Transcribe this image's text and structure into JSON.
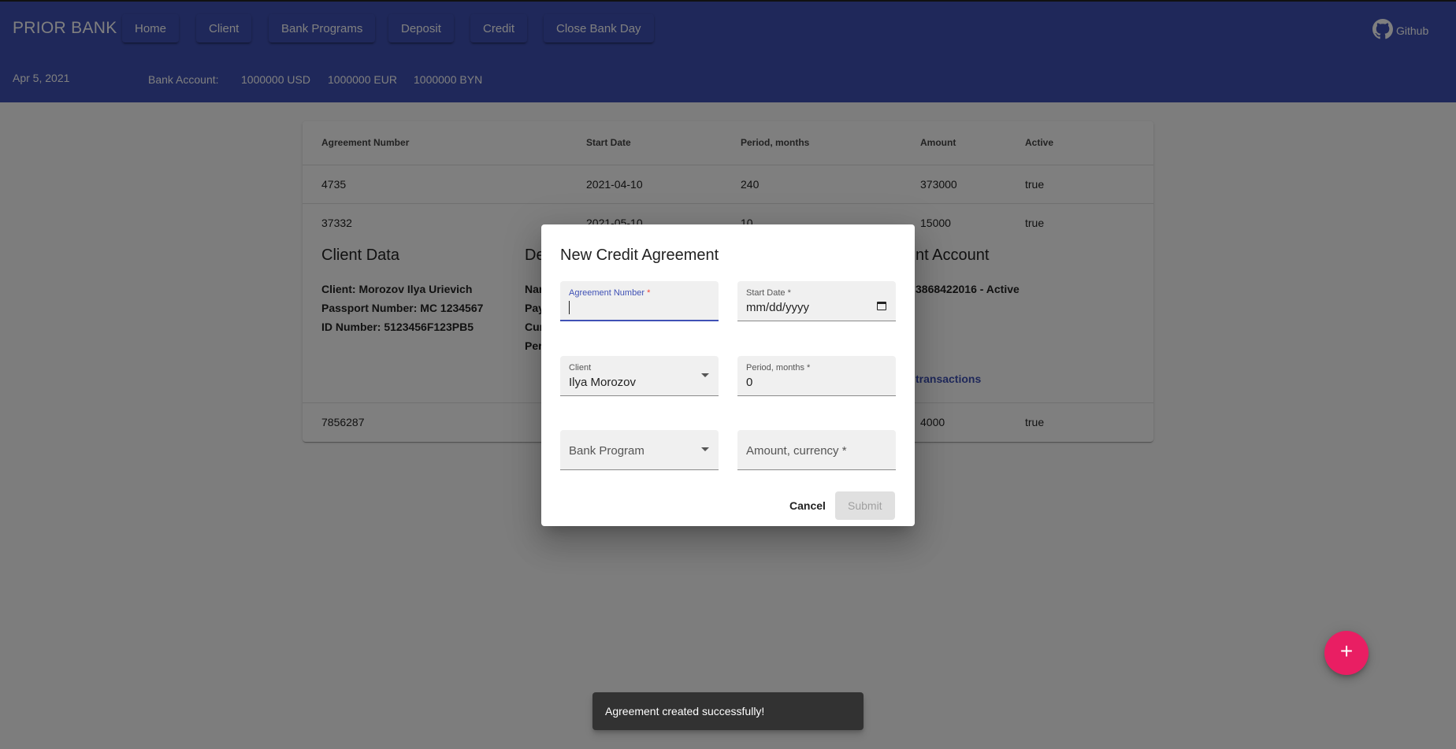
{
  "app": {
    "brand": "PRIOR BANK",
    "nav": [
      "Home",
      "Client",
      "Bank Programs",
      "Deposit",
      "Credit",
      "Close Bank Day"
    ],
    "github": "Github",
    "date": "Apr 5, 2021",
    "bank_account_label": "Bank Account:",
    "bank_accounts": [
      "1000000 USD",
      "1000000 EUR",
      "1000000 BYN"
    ]
  },
  "table": {
    "headers": [
      "Agreement Number",
      "Start Date",
      "Period, months",
      "Amount",
      "Active"
    ],
    "rows": [
      [
        "4735",
        "2021-04-10",
        "240",
        "373000",
        "true"
      ],
      [
        "37332",
        "2021-05-10",
        "10",
        "15000",
        "true"
      ],
      [
        "7856287",
        "",
        "",
        "4000",
        "true"
      ]
    ],
    "details": {
      "client_heading": "Client Data",
      "client_lines": [
        "Client: Morozov Ilya Urievich",
        "Passport Number: MC 1234567",
        "ID Number: 5123456F123PB5"
      ],
      "deposit_heading_fragment": "De",
      "deposit_fragments": [
        "Nar",
        "Pay",
        "Cur",
        "Per"
      ],
      "account_heading_fragment": "nt Account",
      "account_line_fragment": "3868422016 - Active",
      "transactions_link_fragment": "transactions"
    }
  },
  "dialog": {
    "title": "New Credit Agreement",
    "fields": {
      "agreement_number": {
        "label": "Agreement Number",
        "value": ""
      },
      "start_date": {
        "label": "Start Date",
        "value": "mm/dd/yyyy"
      },
      "client": {
        "label": "Client",
        "value": "Ilya Morozov"
      },
      "period": {
        "label": "Period, months",
        "value": "0"
      },
      "bank_program": {
        "label": "Bank Program",
        "value": ""
      },
      "amount": {
        "label": "Amount, currency",
        "value": ""
      }
    },
    "required_mark": "*",
    "cancel": "Cancel",
    "submit": "Submit"
  },
  "fab": {
    "icon": "plus-icon",
    "glyph": "+"
  },
  "snackbar": {
    "message": "Agreement created successfully!"
  },
  "colors": {
    "primary": "#3f51b5",
    "accent": "#e91e63",
    "required": "#f44336"
  }
}
